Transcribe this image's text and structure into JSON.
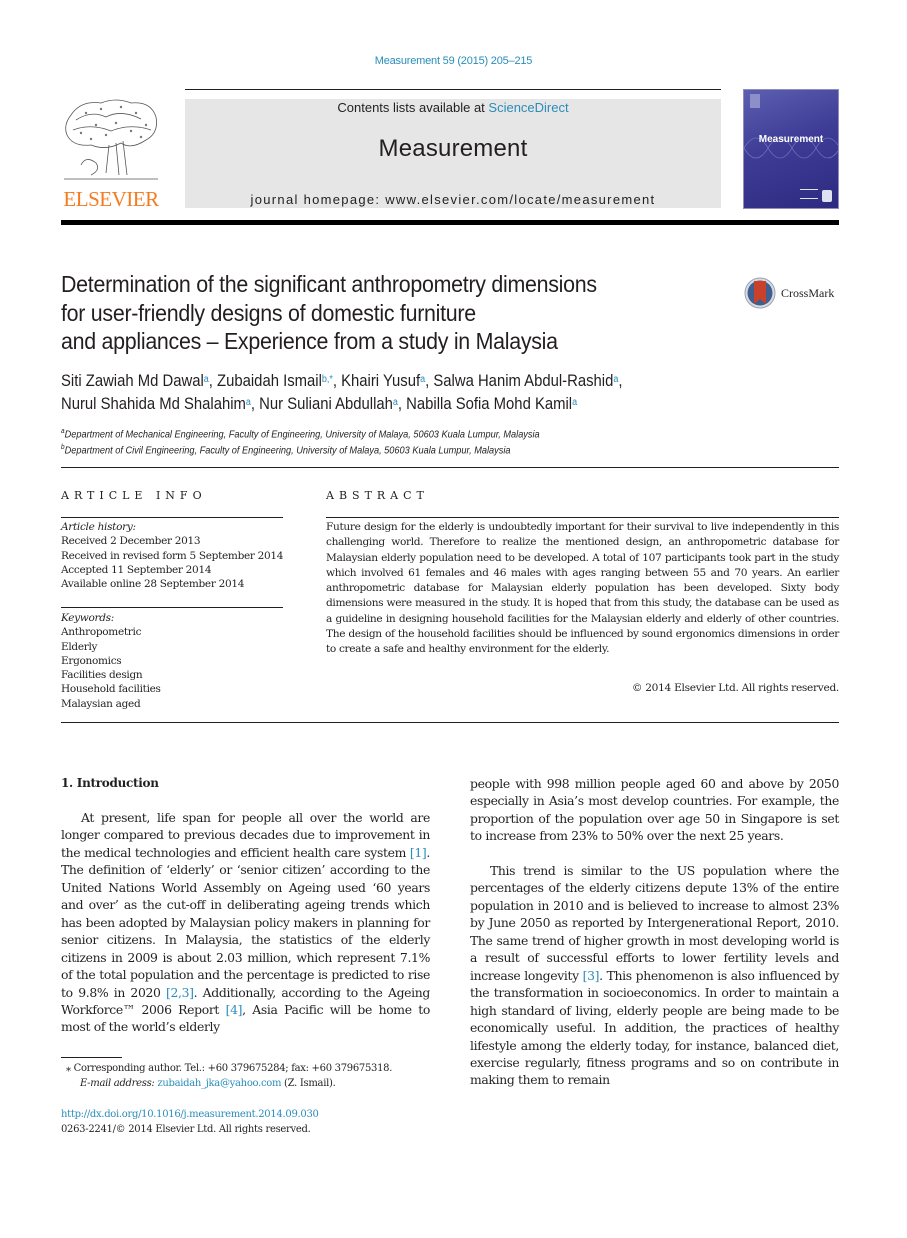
{
  "header": {
    "journal_ref": "Measurement 59 (2015) 205–215",
    "contents_prefix": "Contents lists available at ",
    "contents_link": "ScienceDirect",
    "journal_title": "Measurement",
    "homepage": "journal homepage: www.elsevier.com/locate/measurement",
    "publisher_logo_text": "ELSEVIER",
    "cover_title": "Measurement",
    "crossmark_label": "CrossMark"
  },
  "colors": {
    "link": "#2a8cba",
    "elsevier_orange": "#f47b20",
    "masthead_bg": "#e6e6e6",
    "cover_purple": "#3e3c96",
    "crossmark_red": "#c9412b"
  },
  "article": {
    "title_lines": [
      "Determination of the significant anthropometry dimensions",
      "for user-friendly designs of domestic furniture",
      "and appliances – Experience from a study in Malaysia"
    ],
    "authors": [
      {
        "name": "Siti Zawiah Md Dawal",
        "aff": "a"
      },
      {
        "name": "Zubaidah Ismail",
        "aff": "b,*"
      },
      {
        "name": "Khairi Yusuf",
        "aff": "a"
      },
      {
        "name": "Salwa Hanim Abdul-Rashid",
        "aff": "a"
      },
      {
        "name": "Nurul Shahida Md Shalahim",
        "aff": "a"
      },
      {
        "name": "Nur Suliani Abdullah",
        "aff": "a"
      },
      {
        "name": "Nabilla Sofia Mohd Kamil",
        "aff": "a"
      }
    ],
    "affiliations": [
      {
        "key": "a",
        "text": "Department of Mechanical Engineering, Faculty of Engineering, University of Malaya, 50603 Kuala Lumpur, Malaysia"
      },
      {
        "key": "b",
        "text": "Department of Civil Engineering, Faculty of Engineering, University of Malaya, 50603 Kuala Lumpur, Malaysia"
      }
    ]
  },
  "article_info": {
    "heading": "ARTICLE INFO",
    "history_label": "Article history:",
    "history": [
      "Received 2 December 2013",
      "Received in revised form 5 September 2014",
      "Accepted 11 September 2014",
      "Available online 28 September 2014"
    ],
    "keywords_label": "Keywords:",
    "keywords": [
      "Anthropometric",
      "Elderly",
      "Ergonomics",
      "Facilities design",
      "Household facilities",
      "Malaysian aged"
    ]
  },
  "abstract": {
    "heading": "ABSTRACT",
    "text": "Future design for the elderly is undoubtedly important for their survival to live independently in this challenging world. Therefore to realize the mentioned design, an anthropometric database for Malaysian elderly population need to be developed. A total of 107 participants took part in the study which involved 61 females and 46 males with ages ranging between 55 and 70 years. An earlier anthropometric database for Malaysian elderly population has been developed. Sixty body dimensions were measured in the study. It is hoped that from this study, the database can be used as a guideline in designing household facilities for the Malaysian elderly and elderly of other countries. The design of the household facilities should be influenced by sound ergonomics dimensions in order to create a safe and healthy environment for the elderly.",
    "copyright": "© 2014 Elsevier Ltd. All rights reserved."
  },
  "introduction": {
    "heading": "1. Introduction",
    "left_parts": [
      "At present, life span for people all over the world are longer compared to previous decades due to improvement in the medical technologies and efficient health care system ",
      "[1]",
      ". The definition of ‘elderly’ or ‘senior citizen’ according to the United Nations World Assembly on Ageing used ‘60 years and over’ as the cut-off in deliberating ageing trends which has been adopted by Malaysian policy makers in planning for senior citizens. In Malaysia, the statistics of the elderly citizens in 2009 is about 2.03 million, which represent 7.1% of the total population and the percentage is predicted to rise to 9.8% in 2020 ",
      "[2,3]",
      ". Additionally, according to the Ageing Workforce™ 2006 Report ",
      "[4]",
      ", Asia Pacific will be home to most of the world’s elderly"
    ],
    "right_para1": "people with 998 million people aged 60 and above by 2050 especially in Asia’s most develop countries. For example, the proportion of the population over age 50 in Singapore is set to increase from 23% to 50% over the next 25 years.",
    "right_para2_parts": [
      "This trend is similar to the US population where the percentages of the elderly citizens depute 13% of the entire population in 2010 and is believed to increase to almost 23% by June 2050 as reported by Intergenerational Report, 2010. The same trend of higher growth in most developing world is a result of successful efforts to lower fertility levels and increase longevity ",
      "[3]",
      ". This phenomenon is also influenced by the transformation in socioeconomics. In order to maintain a high standard of living, elderly people are being made to be economically useful. In addition, the practices of healthy lifestyle among the elderly today, for instance, balanced diet, exercise regularly, fitness programs and so on contribute in making them to remain"
    ]
  },
  "footnote": {
    "marker": "⁎",
    "corresponding": "Corresponding author. Tel.: +60 379675284; fax: +60 379675318.",
    "email_label": "E-mail address:",
    "email": "zubaidah_jka@yahoo.com",
    "email_suffix": " (Z. Ismail).",
    "doi": "http://dx.doi.org/10.1016/j.measurement.2014.09.030",
    "issn_line": "0263-2241/© 2014 Elsevier Ltd. All rights reserved."
  }
}
